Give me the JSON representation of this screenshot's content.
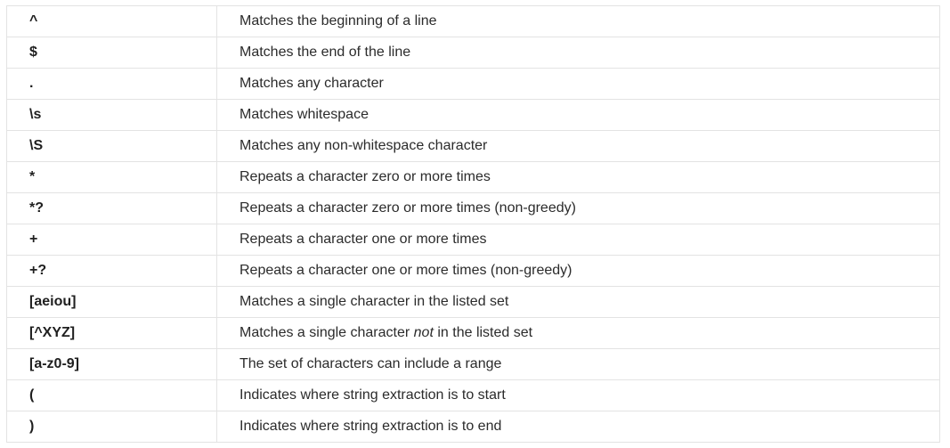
{
  "rows": [
    {
      "pattern": "^",
      "description": "Matches the beginning of a line"
    },
    {
      "pattern": "$",
      "description": "Matches the end of the line"
    },
    {
      "pattern": ".",
      "description": "Matches any character"
    },
    {
      "pattern": "\\s",
      "description": "Matches whitespace"
    },
    {
      "pattern": "\\S",
      "description": "Matches any non-whitespace character"
    },
    {
      "pattern": "*",
      "description": "Repeats a character zero or more times"
    },
    {
      "pattern": "*?",
      "description": "Repeats a character zero or more times (non-greedy)"
    },
    {
      "pattern": "+",
      "description": "Repeats a character one or more times"
    },
    {
      "pattern": "+?",
      "description": "Repeats a character one or more times (non-greedy)"
    },
    {
      "pattern": "[aeiou]",
      "description": "Matches a single character in the listed set"
    },
    {
      "pattern": "[^XYZ]",
      "description_before": "Matches a single character ",
      "description_emphasis": "not",
      "description_after": " in the listed set"
    },
    {
      "pattern": "[a-z0-9]",
      "description": "The set of characters can include a range"
    },
    {
      "pattern": "(",
      "description": "Indicates where string extraction is to start"
    },
    {
      "pattern": ")",
      "description": "Indicates where string extraction is to end"
    }
  ]
}
